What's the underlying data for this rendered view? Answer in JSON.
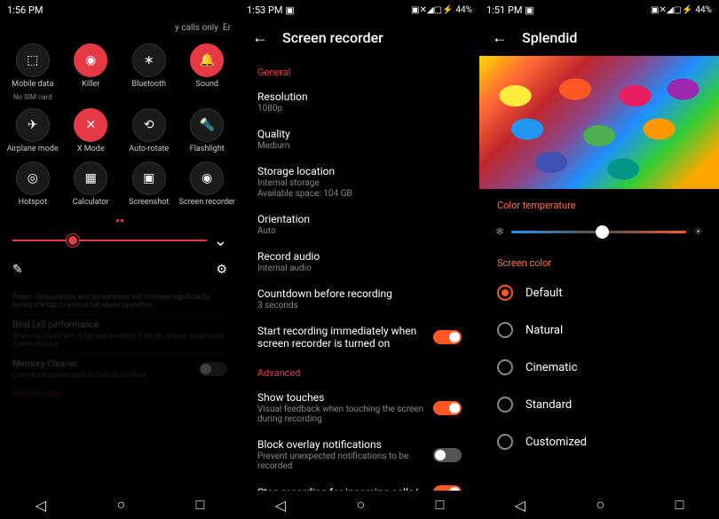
{
  "panel1": {
    "time": "1:56 PM",
    "header_text": "y calls only",
    "header_suffix": "Er",
    "tiles": [
      {
        "label": "Mobile data",
        "sublabel": "No SIM card",
        "active": false,
        "icon": "mobile-data"
      },
      {
        "label": "Killer",
        "sublabel": "",
        "active": true,
        "icon": "wifi"
      },
      {
        "label": "Bluetooth",
        "sublabel": "",
        "active": false,
        "icon": "bluetooth"
      },
      {
        "label": "Sound",
        "sublabel": "",
        "active": true,
        "icon": "bell"
      },
      {
        "label": "Airplane mode",
        "sublabel": "",
        "active": false,
        "icon": "airplane"
      },
      {
        "label": "X Mode",
        "sublabel": "",
        "active": true,
        "icon": "x-mode"
      },
      {
        "label": "Auto-rotate",
        "sublabel": "",
        "active": false,
        "icon": "rotate"
      },
      {
        "label": "Flashlight",
        "sublabel": "",
        "active": false,
        "icon": "flashlight"
      },
      {
        "label": "Hotspot",
        "sublabel": "",
        "active": false,
        "icon": "hotspot"
      },
      {
        "label": "Calculator",
        "sublabel": "",
        "active": false,
        "icon": "calculator"
      },
      {
        "label": "Screenshot",
        "sublabel": "",
        "active": false,
        "icon": "screenshot"
      },
      {
        "label": "Screen recorder",
        "sublabel": "",
        "active": false,
        "icon": "record"
      }
    ],
    "dimmed": {
      "intro": "Power consumption and temperature will increase significantly during startup to ensure full speed operation.",
      "bind_title": "Bind Lv3 performance",
      "bind_sub": "When equipped with a fan and enabling X Mode, always apply Level 3 performance",
      "memory_title": "Memory Cleaner",
      "memory_sub": "Clean background apps to free up memory",
      "refresh": "Refresh rate"
    }
  },
  "panel2": {
    "time": "1:53 PM",
    "battery": "44%",
    "title": "Screen recorder",
    "section_general": "General",
    "section_advanced": "Advanced",
    "items": {
      "resolution": {
        "title": "Resolution",
        "sub": "1080p"
      },
      "quality": {
        "title": "Quality",
        "sub": "Medium"
      },
      "storage": {
        "title": "Storage location",
        "sub": "Internal storage",
        "sub2": "Available space: 104 GB"
      },
      "orientation": {
        "title": "Orientation",
        "sub": "Auto"
      },
      "audio": {
        "title": "Record audio",
        "sub": "Internal audio"
      },
      "countdown": {
        "title": "Countdown before recording",
        "sub": "3 seconds"
      },
      "immediate": {
        "title": "Start recording immediately when screen recorder is turned on"
      },
      "touches": {
        "title": "Show touches",
        "sub": "Visual feedback when touching the screen during recording"
      },
      "block": {
        "title": "Block overlay notifications",
        "sub": "Prevent unexpected notifications to be recorded"
      },
      "stop": {
        "title": "Stop recording for incoming calls/"
      }
    }
  },
  "panel3": {
    "time": "1:51 PM",
    "battery": "44%",
    "title": "Splendid",
    "color_temp_label": "Color temperature",
    "screen_color_label": "Screen color",
    "options": [
      "Default",
      "Natural",
      "Cinematic",
      "Standard",
      "Customized"
    ],
    "selected": "Default"
  }
}
